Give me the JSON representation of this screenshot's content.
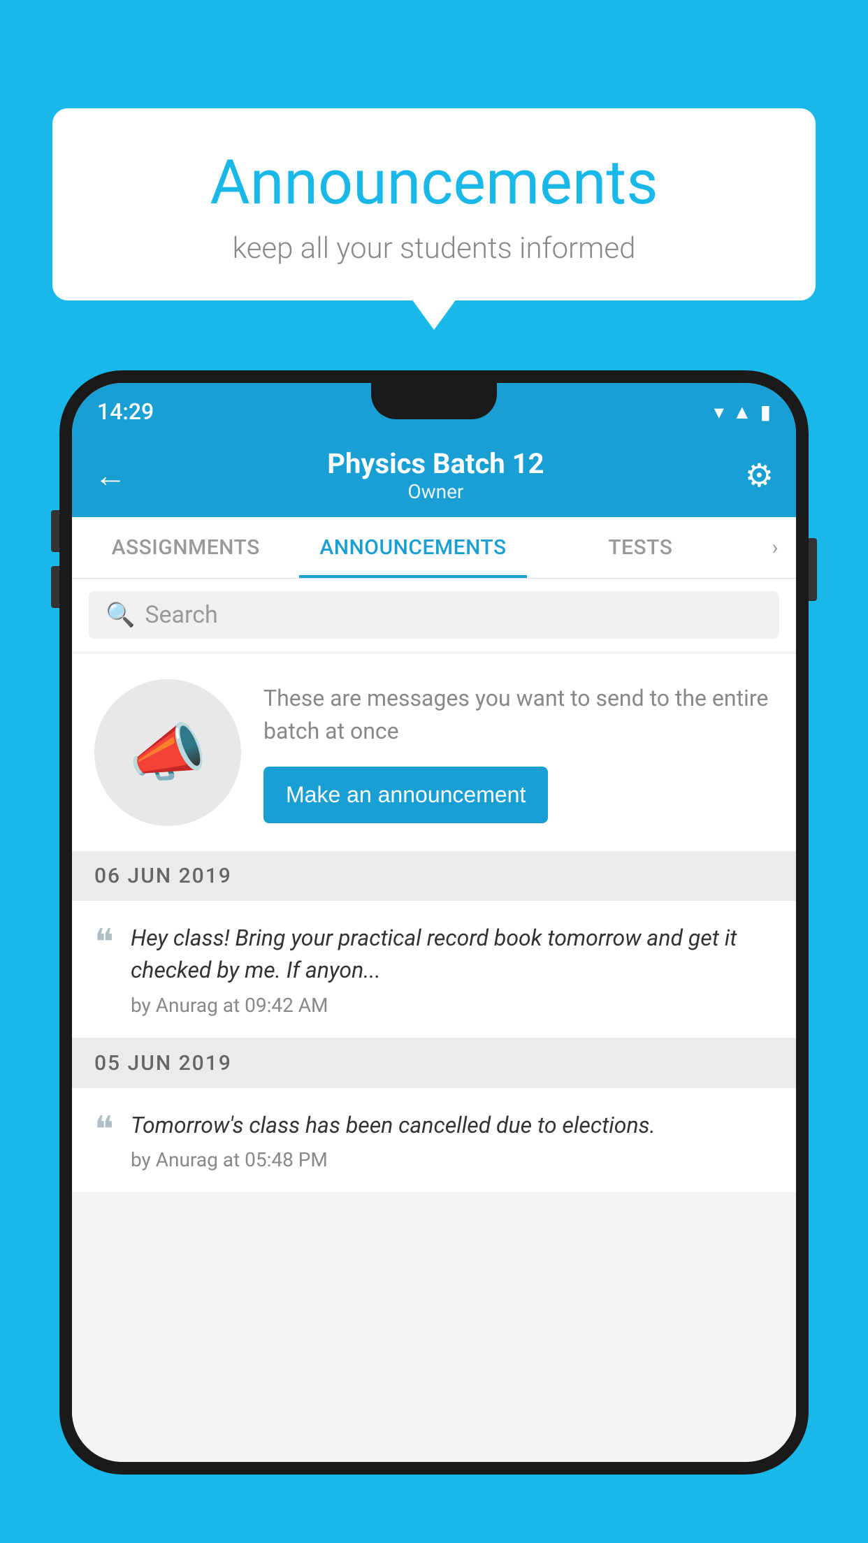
{
  "bubble": {
    "title": "Announcements",
    "subtitle": "keep all your students informed"
  },
  "phone": {
    "statusBar": {
      "time": "14:29"
    },
    "header": {
      "title": "Physics Batch 12",
      "subtitle": "Owner",
      "backLabel": "←",
      "gearLabel": "⚙"
    },
    "tabs": [
      {
        "label": "ASSIGNMENTS",
        "active": false
      },
      {
        "label": "ANNOUNCEMENTS",
        "active": true
      },
      {
        "label": "TESTS",
        "active": false
      }
    ],
    "search": {
      "placeholder": "Search"
    },
    "emptyState": {
      "description": "These are messages you want to\nsend to the entire batch at once",
      "buttonLabel": "Make an announcement"
    },
    "announcements": [
      {
        "date": "06  JUN  2019",
        "text": "Hey class! Bring your practical record book tomorrow and get it checked by me. If anyon...",
        "meta": "by Anurag at 09:42 AM"
      },
      {
        "date": "05  JUN  2019",
        "text": "Tomorrow's class has been cancelled due to elections.",
        "meta": "by Anurag at 05:48 PM"
      }
    ]
  }
}
